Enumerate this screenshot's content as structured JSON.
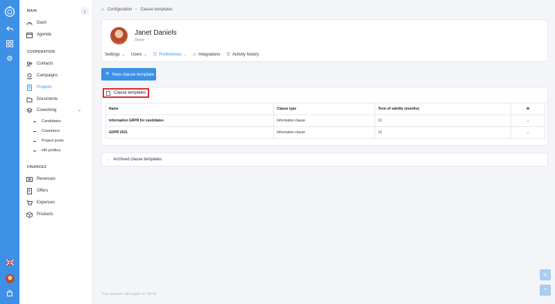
{
  "rail": {
    "icons": [
      "logo-icon",
      "back-icon",
      "grid-icon",
      "settings-icon",
      "uk-flag-icon",
      "avatar",
      "lock-icon"
    ]
  },
  "sidebar": {
    "collapse_icon": "‹",
    "sections": {
      "main": "MAIN",
      "cooperation": "COOPERATION",
      "finances": "FINANCES"
    },
    "main_items": [
      {
        "label": "Dash",
        "icon": "dashboard-icon"
      },
      {
        "label": "Agenda",
        "icon": "calendar-icon"
      }
    ],
    "cooperation_items": [
      {
        "label": "Contacts",
        "icon": "contacts-icon"
      },
      {
        "label": "Campaigns",
        "icon": "campaigns-icon"
      },
      {
        "label": "Projects",
        "icon": "projects-icon",
        "active": true
      },
      {
        "label": "Documents",
        "icon": "documents-icon"
      },
      {
        "label": "Coworking",
        "icon": "coworking-icon",
        "expanded": true
      }
    ],
    "coworking_sub": [
      "Candidates",
      "Coworkers",
      "Project posts",
      "HR profiles"
    ],
    "finance_items": [
      {
        "label": "Revenues",
        "icon": "revenues-icon"
      },
      {
        "label": "Offers",
        "icon": "offers-icon"
      },
      {
        "label": "Expenses",
        "icon": "expenses-icon"
      },
      {
        "label": "Products",
        "icon": "products-icon"
      }
    ]
  },
  "breadcrumb": {
    "home_icon": "⌂",
    "root": "Configuration",
    "sep": "›",
    "current": "Clause templates"
  },
  "profile": {
    "name": "Janet Daniels",
    "role": "Owner",
    "tabs": [
      {
        "label": "Settings",
        "icon": "",
        "caret": true
      },
      {
        "label": "Users",
        "icon": "",
        "caret": true
      },
      {
        "label": "Preferences",
        "icon": "☷",
        "caret": true,
        "active": true
      },
      {
        "label": "Integrations",
        "icon": "⚏",
        "caret": false
      },
      {
        "label": "Activity history",
        "icon": "☰",
        "caret": false
      }
    ]
  },
  "new_button": {
    "plus": "+",
    "label": "New clause template"
  },
  "clause_templates": {
    "title": "Clause templates",
    "columns": [
      "Name",
      "Clause type",
      "Term of validity (months)",
      "⚙"
    ],
    "rows": [
      {
        "name": "Information GRPR for candidates",
        "type": "Information clause",
        "term": "12",
        "action": "⌄"
      },
      {
        "name": "GDPR 2021",
        "type": "Information clause",
        "term": "12",
        "action": "⌄"
      }
    ]
  },
  "archived": {
    "chevron": "⌄",
    "label": "Archived clause templates"
  },
  "session": "Your session will expire in: 59:49",
  "fabs": {
    "edit": "✎",
    "top": "⌃"
  },
  "colors": {
    "accent": "#3e8fe6",
    "highlight": "#d6262b"
  }
}
